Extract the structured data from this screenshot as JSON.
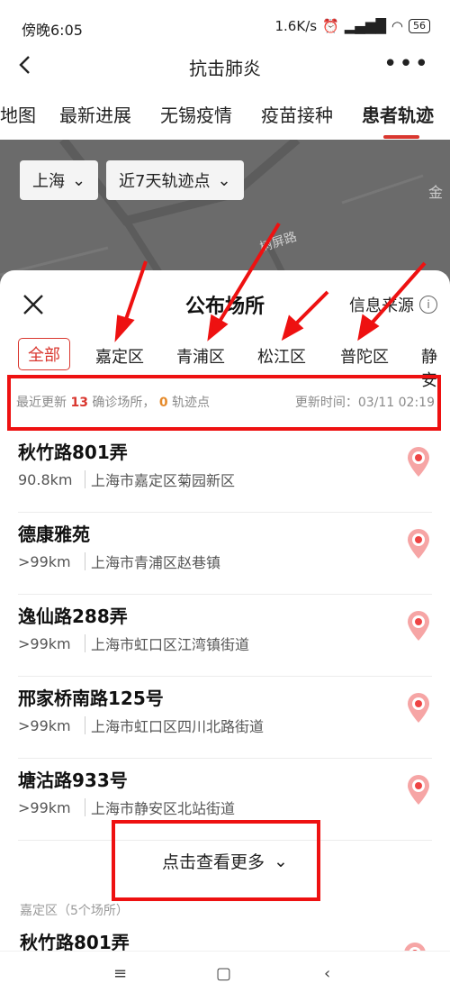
{
  "status": {
    "time": "傍晚6:05",
    "speed": "1.6K/s",
    "battery": "56"
  },
  "topbar": {
    "title": "抗击肺炎"
  },
  "tabs": [
    {
      "label": "地图"
    },
    {
      "label": "最新进展"
    },
    {
      "label": "无锡疫情"
    },
    {
      "label": "疫苗接种"
    },
    {
      "label": "患者轨迹"
    }
  ],
  "map": {
    "city": "上海",
    "range": "近7天轨迹点",
    "road_label": "树屏路",
    "corner_label": "金"
  },
  "sheet": {
    "title": "公布场所",
    "source_label": "信息来源",
    "districts": [
      "全部",
      "嘉定区",
      "青浦区",
      "松江区",
      "普陀区",
      "静安"
    ],
    "summary": {
      "prefix": "最近更新",
      "count": "13",
      "count_label": "确诊场所，",
      "tracks": "0",
      "tracks_label": "轨迹点",
      "time_label": "更新时间：",
      "time": "03/11 02:19"
    },
    "items": [
      {
        "name": "秋竹路801弄",
        "distance": "90.8km",
        "address": "上海市嘉定区菊园新区"
      },
      {
        "name": "德康雅苑",
        "distance": ">99km",
        "address": "上海市青浦区赵巷镇"
      },
      {
        "name": "逸仙路288弄",
        "distance": ">99km",
        "address": "上海市虹口区江湾镇街道"
      },
      {
        "name": "邢家桥南路125号",
        "distance": ">99km",
        "address": "上海市虹口区四川北路街道"
      },
      {
        "name": "塘沽路933号",
        "distance": ">99km",
        "address": "上海市静安区北站街道"
      }
    ],
    "more_label": "点击查看更多",
    "group_label": "嘉定区（5个场所）",
    "next_item": "秋竹路801弄"
  },
  "colors": {
    "accent": "#d9372f",
    "annotation": "#e11111",
    "map_bg": "#6b6b6b"
  }
}
